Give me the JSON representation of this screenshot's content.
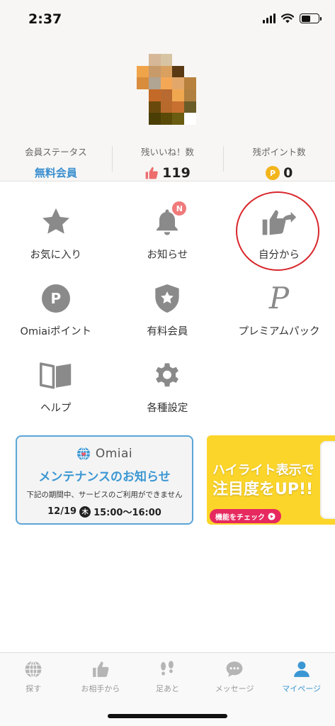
{
  "status_bar": {
    "time": "2:37"
  },
  "profile": {
    "avatar_colors": [
      "#f7f6f4",
      "#d6b898",
      "#d6c4a2",
      "#f7f6f4",
      "#f7f6f4",
      "#f0a44a",
      "#c89a6a",
      "#d9a060",
      "#5a3a14",
      "#f7f6f4",
      "#d88c3c",
      "#b0a492",
      "#f4a856",
      "#e2a76a",
      "#b8823e",
      "#f7f6f4",
      "#c46a28",
      "#b86a30",
      "#f0a850",
      "#b08040",
      "#f7f6f4",
      "#6a4a0c",
      "#b86a2c",
      "#c87030",
      "#6a5c28",
      "#f7f6f4",
      "#4a3e04",
      "#5a4a08",
      "#6a5c10",
      "#ffffff"
    ],
    "stats": [
      {
        "label": "会員ステータス",
        "value": "無料会員"
      },
      {
        "label": "残いいね！数",
        "value": "119"
      },
      {
        "label": "残ポイント数",
        "value": "0",
        "coin": "P"
      }
    ]
  },
  "menu": {
    "rows": [
      [
        {
          "label": "お気に入り",
          "icon": "star-icon"
        },
        {
          "label": "お知らせ",
          "icon": "bell-icon",
          "badge": "N"
        },
        {
          "label": "自分から",
          "icon": "thumbs-up-share-icon"
        }
      ],
      [
        {
          "label": "Omiaiポイント",
          "icon": "points-icon",
          "glyph": "P"
        },
        {
          "label": "有料会員",
          "icon": "shield-star-icon"
        },
        {
          "label": "プレミアムパック",
          "icon": "premium-p-icon",
          "glyph": "P"
        }
      ],
      [
        {
          "label": "ヘルプ",
          "icon": "book-icon"
        },
        {
          "label": "各種設定",
          "icon": "gear-icon"
        }
      ]
    ]
  },
  "banners": {
    "maintenance": {
      "brand": "Omiai",
      "title": "メンテナンスのお知らせ",
      "subtitle": "下記の期間中、サービスのご利用ができません",
      "date": "12/19",
      "day": "木",
      "time": "15:00〜16:00"
    },
    "promo": {
      "line1": "ハイライト表示で",
      "line2": "注目度をUP!!",
      "button": "機能をチェック"
    }
  },
  "tabs": [
    {
      "label": "探す",
      "icon": "globe-icon"
    },
    {
      "label": "お相手から",
      "icon": "thumbs-up-icon"
    },
    {
      "label": "足あと",
      "icon": "footprints-icon"
    },
    {
      "label": "メッセージ",
      "icon": "chat-icon"
    },
    {
      "label": "マイページ",
      "icon": "person-icon",
      "active": true
    }
  ],
  "colors": {
    "accent": "#3b97d3",
    "icon_gray": "#8a8a8a",
    "highlight_circle": "#d8262b",
    "promo_yellow": "#fcd52b",
    "promo_button": "#e6295f"
  }
}
